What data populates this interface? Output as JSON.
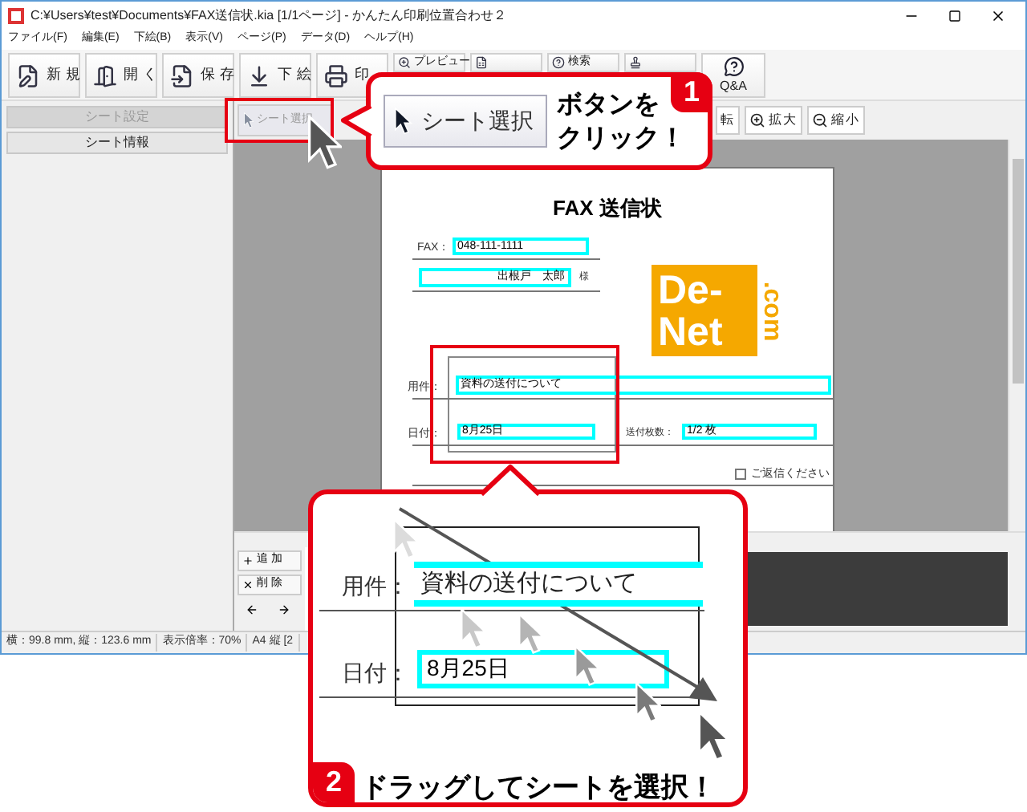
{
  "window": {
    "title": "C:¥Users¥test¥Documents¥FAX送信状.kia [1/1ページ] - かんたん印刷位置合わせ２"
  },
  "menu": [
    "ファイル(F)",
    "編集(E)",
    "下絵(B)",
    "表示(V)",
    "ページ(P)",
    "データ(D)",
    "ヘルプ(H)"
  ],
  "toolbar": [
    {
      "kind": "large",
      "label": "新規"
    },
    {
      "kind": "large",
      "label": "開く"
    },
    {
      "kind": "large",
      "label": "保存"
    },
    {
      "kind": "large",
      "label": "下絵"
    },
    {
      "kind": "large",
      "label": "印"
    },
    {
      "kind": "small",
      "label": "プレビュー"
    },
    {
      "kind": "small"
    },
    {
      "kind": "small",
      "label": "検索"
    },
    {
      "kind": "small"
    },
    {
      "kind": "stacked",
      "label": "Q&A"
    }
  ],
  "side_panel": {
    "tabs": [
      {
        "label": "シート設定",
        "disabled": true
      },
      {
        "label": "シート情報",
        "disabled": false
      }
    ]
  },
  "sheet_toolbar": {
    "select_button": "シート選択",
    "buttons": [
      "転",
      "拡大",
      "縮小"
    ]
  },
  "sheet_list_buttons": [
    "追加",
    "削除"
  ],
  "document": {
    "title": "FAX 送信状",
    "fax_label": "FAX：",
    "fax": "048-111-1111",
    "recipient": "出根戸　太郎",
    "honorific": "様",
    "logo": {
      "line_1": "De-",
      "line_2": "Net",
      "suffix": ".com"
    },
    "subject_label": "用件：",
    "subject": "資料の送付について",
    "date_label": "日付：",
    "date": "8月25日",
    "pages_label": "送付枚数：",
    "pages": "1/2 枚",
    "reply": {
      "label": "ご返信ください",
      "checked": false
    }
  },
  "status_bar": [
    "横：99.8 mm, 縦：123.6 mm",
    "表示倍率：70%",
    "A4 縦 [2"
  ],
  "callouts": [
    {
      "number": "1",
      "button": "シート選択",
      "text_lines": [
        "ボタンを",
        "クリック！"
      ]
    },
    {
      "number": "2",
      "subject_label": "用件：",
      "subject": "資料の送付について",
      "date_label": "日付：",
      "date": "8月25日",
      "text": "ドラッグしてシートを選択！"
    }
  ]
}
